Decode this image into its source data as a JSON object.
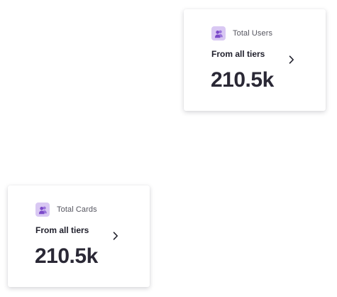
{
  "colors": {
    "icon_badge_bg": "#d9c8f3",
    "icon_fill": "#7b49c9",
    "title_text": "#55555f",
    "subtitle_text": "#1f1f2b",
    "value_text": "#2a2835"
  },
  "cards": [
    {
      "icon": "users-icon",
      "title": "Total Users",
      "subtitle": "From all tiers",
      "value": "210.5k",
      "action_icon": "chevron-right-icon"
    },
    {
      "icon": "users-icon",
      "title": "Total Cards",
      "subtitle": "From all tiers",
      "value": "210.5k",
      "action_icon": "chevron-right-icon"
    }
  ]
}
